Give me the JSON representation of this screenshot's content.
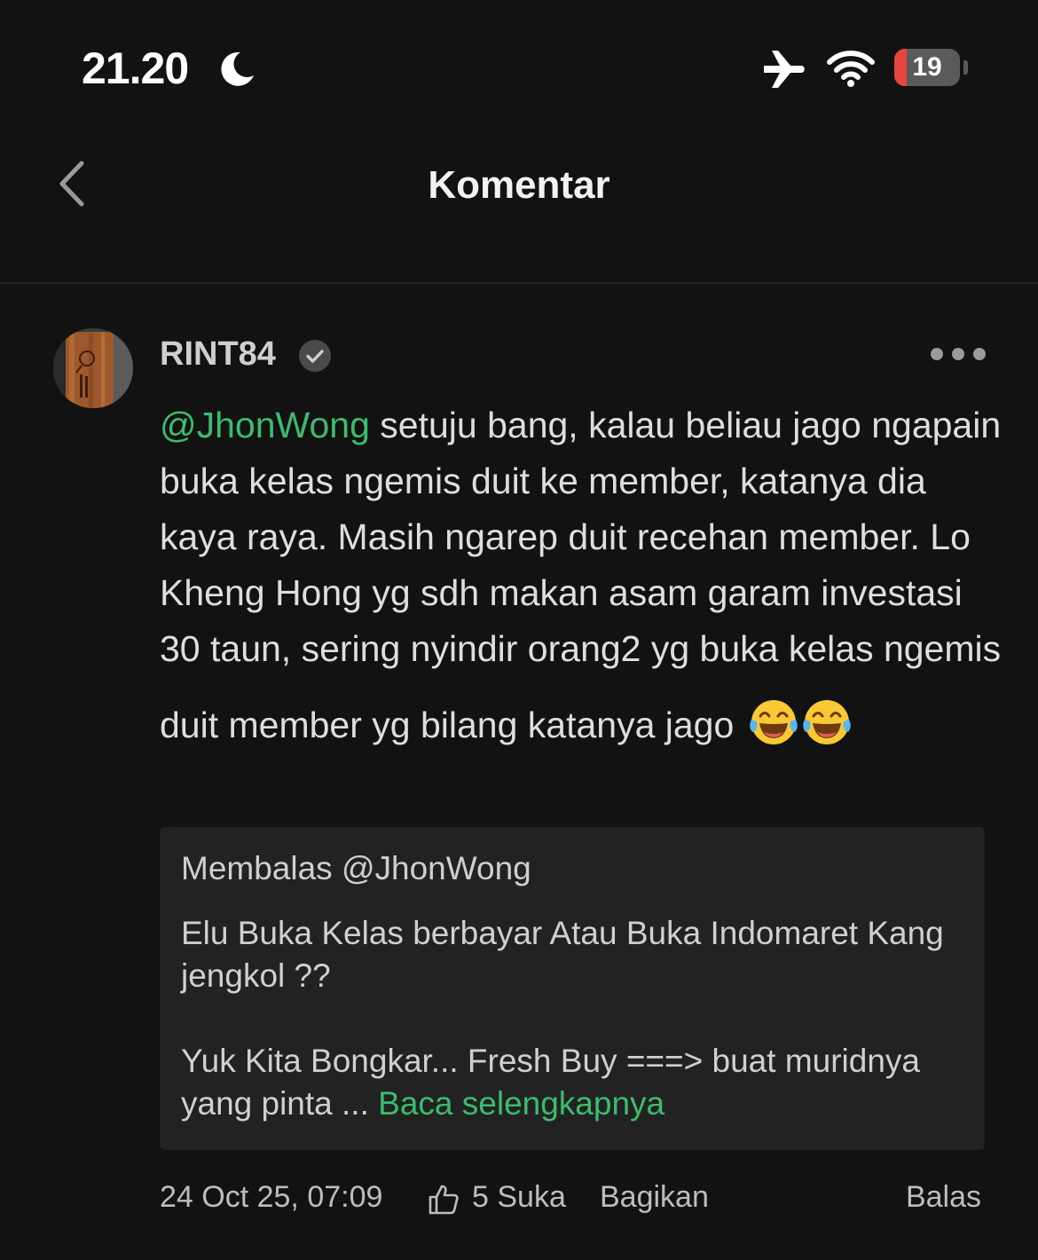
{
  "status_bar": {
    "time": "21.20",
    "battery_level": "19",
    "battery_fraction": 0.19,
    "icons": [
      "moon-icon",
      "airplane-icon",
      "wifi-icon",
      "battery-icon"
    ]
  },
  "header": {
    "title": "Komentar",
    "back_icon": "chevron-left-icon"
  },
  "comment": {
    "username": "RINT84",
    "verified": true,
    "more_icon": "ellipsis-icon",
    "mention": "@JhonWong",
    "text": " setuju bang, kalau beliau jago ngapain buka kelas ngemis duit ke member, katanya dia kaya raya. Masih ngarep duit recehan member. Lo Kheng Hong yg sdh makan asam garam investasi 30 taun, sering nyindir orang2 yg buka kelas ngemis",
    "text_last_line": "duit member yg bilang katanya jago ",
    "emojis": [
      "laughing-tears-emoji",
      "laughing-tears-emoji"
    ],
    "quote": {
      "header": "Membalas  @JhonWong",
      "paragraph_1": "Elu Buka Kelas berbayar Atau Buka Indomaret Kang jengkol ??",
      "paragraph_2": "Yuk Kita Bongkar... Fresh Buy ===> buat muridnya yang pinta ... ",
      "read_more": "Baca selengkapnya"
    },
    "footer": {
      "timestamp": "24 Oct 25, 07:09",
      "like_label": "5 Suka",
      "share_label": "Bagikan",
      "reply_label": "Balas"
    }
  },
  "colors": {
    "background": "#121212",
    "accent_green": "#3dbb6e",
    "quote_background": "#222222",
    "battery_low": "#e4473c"
  }
}
